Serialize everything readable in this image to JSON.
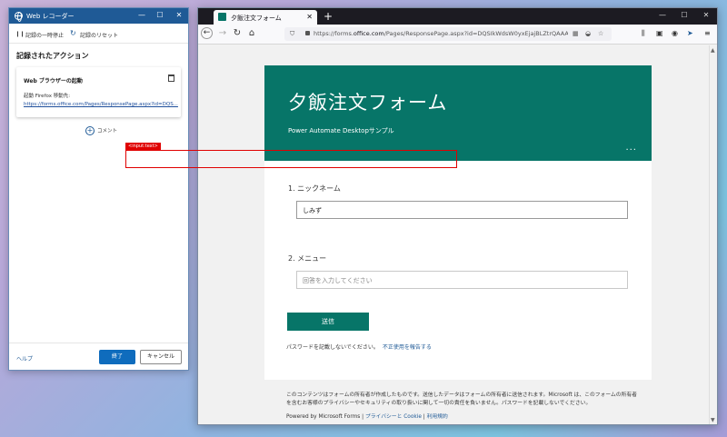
{
  "recorder": {
    "title": "Web レコーダー",
    "pause_label": "記録の一時停止",
    "reset_label": "記録のリセット",
    "heading": "記録されたアクション",
    "action": {
      "title": "Web ブラウザーの起動",
      "line1": "起動 Firefox 移動先:",
      "line2": "https://forms.office.com/Pages/ResponsePage.aspx?id=DQS..."
    },
    "comment_label": "コメント",
    "help_label": "ヘルプ",
    "finish_label": "終了",
    "cancel_label": "キャンセル"
  },
  "browser": {
    "tab_title": "夕飯注文フォーム",
    "url_prefix": "https://forms.",
    "url_domain": "office.com",
    "url_rest": "/Pages/ResponsePage.aspx?id=DQSIkWdsW0yxEjajBLZtrQAAAAAA"
  },
  "form": {
    "title": "夕飯注文フォーム",
    "subtitle": "Power Automate Desktopサンプル",
    "more": "...",
    "q1_label": "1. ニックネーム",
    "q1_value": "しみず",
    "q2_label": "2. メニュー",
    "q2_placeholder": "回答を入力してください",
    "submit_label": "送信",
    "pw_note": "パスワードを記載しないでください。",
    "report_link": "不正使用を報告する",
    "disclaimer": "このコンテンツはフォームの所有者が作成したものです。送信したデータはフォームの所有者に送信されます。Microsoft は、このフォームの所有者を含むお客様のプライバシーやセキュリティの取り扱いに関して一切の責任を負いません。パスワードを記載しないでください。",
    "powered": "Powered by Microsoft Forms | ",
    "privacy_link": "プライバシーと Cookie",
    "sep": " | ",
    "terms_link": "利用規約"
  },
  "overlay": {
    "tag": "<input:text>"
  },
  "colors": {
    "form_accent": "#077568",
    "recorder_title": "#1f5a96",
    "highlight": "#e00000"
  }
}
